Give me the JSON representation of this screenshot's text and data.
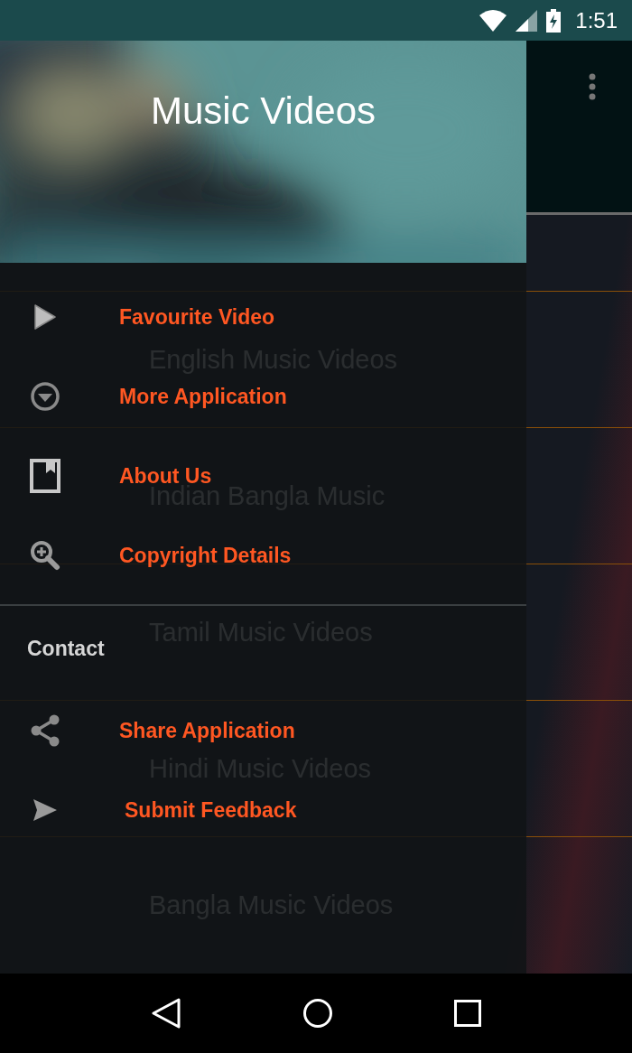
{
  "status_bar": {
    "time": "1:51"
  },
  "video_list": {
    "items": [
      {
        "title": "English Music Videos"
      },
      {
        "title": "Indian Bangla Music"
      },
      {
        "title": "Tamil Music Videos"
      },
      {
        "title": "Hindi Music Videos"
      },
      {
        "title": "Bangla Music Videos"
      }
    ]
  },
  "drawer": {
    "title": "Music Videos",
    "sections": [
      {
        "items": [
          {
            "label": "Favourite Video"
          },
          {
            "label": "More Application"
          },
          {
            "label": "About Us"
          },
          {
            "label": "Copyright Details"
          }
        ]
      },
      {
        "header": "Contact",
        "items": [
          {
            "label": "Share Application"
          },
          {
            "label": "Submit Feedback"
          }
        ]
      }
    ]
  }
}
